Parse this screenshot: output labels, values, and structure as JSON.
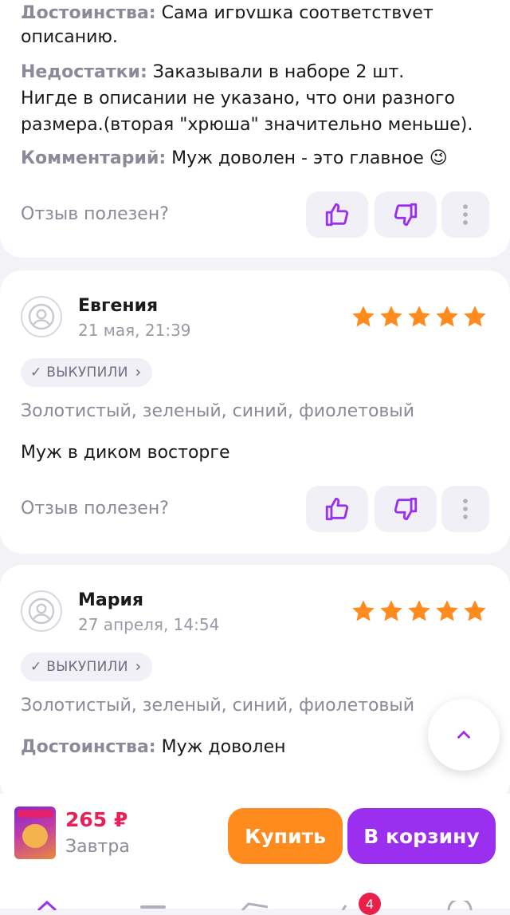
{
  "review1": {
    "pros_label": "Достоинства:",
    "pros_text": "Сама игрушка соответствует",
    "pros_text2": "описанию.",
    "cons_label": "Недостатки:",
    "cons_text": "Заказывали в наборе 2 шт.",
    "cons_text2": "Нигде в описании не указано, что они разного",
    "cons_text3": "размера.(вторая \"хрюша\" значительно меньше).",
    "comment_label": "Комментарий:",
    "comment_text": "Муж доволен - это главное 😉",
    "helpful_label": "Отзыв полезен?"
  },
  "review2": {
    "author": "Евгения",
    "date": "21 мая, 21:39",
    "rating": 5,
    "badge": "✓ ВЫКУПИЛИ",
    "variant": "Золотистый, зеленый, синий, фиолетовый",
    "text": "Муж в диком восторге",
    "helpful_label": "Отзыв полезен?"
  },
  "review3": {
    "author": "Мария",
    "date": "27 апреля, 14:54",
    "rating": 5,
    "badge": "✓ ВЫКУПИЛИ",
    "variant": "Золотистый, зеленый, синий, фиолетовый",
    "pros_label": "Достоинства:",
    "pros_text": "Муж доволен"
  },
  "bottom_bar": {
    "price": "265 ₽",
    "delivery": "Завтра",
    "buy_label": "Купить",
    "cart_label": "В корзину",
    "cart_count": "4"
  },
  "colors": {
    "accent": "#9a2ff0",
    "buy": "#ff8a1e",
    "star": "#ff8a1e",
    "price": "#e8205a"
  },
  "icons": [
    "thumbs-up-icon",
    "thumbs-down-icon",
    "more-vertical-icon",
    "user-avatar-icon",
    "star-icon",
    "chevron-right-icon",
    "chevron-up-icon"
  ]
}
